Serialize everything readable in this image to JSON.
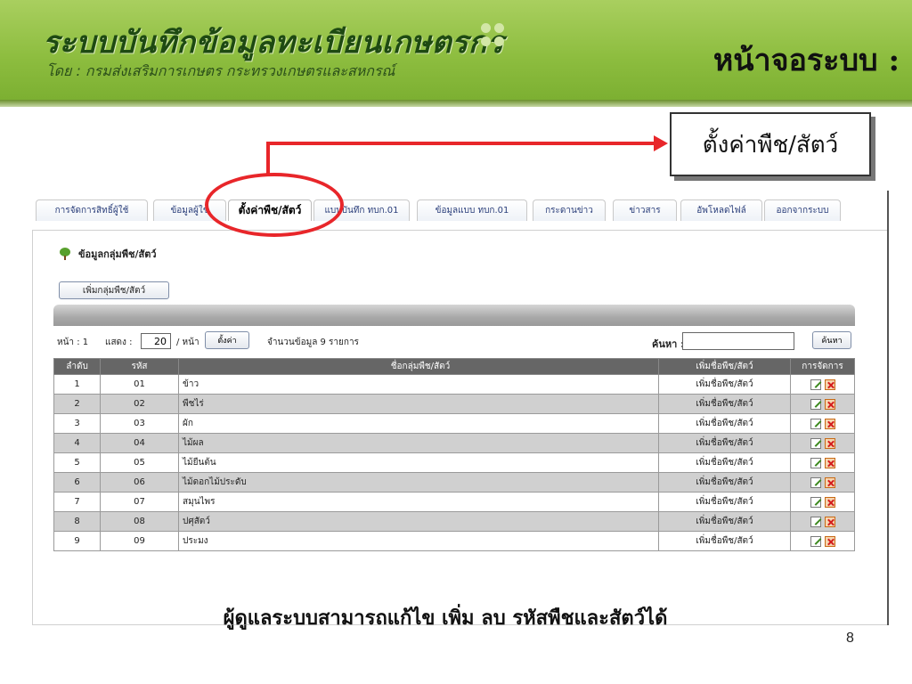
{
  "banner": {
    "logo_title": "ระบบบันทึกข้อมูลทะเบียนเกษตรกร",
    "logo_subtitle": "โดย : กรมส่งเสริมการเกษตร กระทรวงเกษตรและสหกรณ์",
    "screen_title": "หน้าจอระบบ :",
    "color": "#8dbd3f"
  },
  "callout": {
    "label": "ตั้งค่าพืช/สัตว์",
    "arrow_color": "#e8262a"
  },
  "tabs": [
    {
      "label": "การจัดการสิทธิ์ผู้ใช้"
    },
    {
      "label": "ข้อมูลผู้ใช้"
    },
    {
      "label": "ตั้งค่าพืช/สัตว์"
    },
    {
      "label": "แบบบันทึก ทบก.01"
    },
    {
      "label": "ข้อมูลแบบ ทบก.01"
    },
    {
      "label": "กระดานข่าว"
    },
    {
      "label": "ข่าวสาร"
    },
    {
      "label": "อัพโหลดไฟล์"
    },
    {
      "label": "ออกจากระบบ"
    }
  ],
  "section": {
    "title": "ข้อมูลกลุ่มพืช/สัตว์",
    "add_button": "เพิ่มกลุ่มพืช/สัตว์"
  },
  "pager": {
    "page_label": "หน้า : 1",
    "show_label": "แสดง :",
    "page_size": "20",
    "per_page_label": "/ หน้า",
    "set_button": "ตั้งค่า",
    "record_count": "จำนวนข้อมูล 9 รายการ",
    "search_label": "ค้นหา :",
    "search_value": "",
    "search_button": "ค้นหา"
  },
  "table": {
    "headers": {
      "no": "ลำดับ",
      "code": "รหัส",
      "name": "ชื่อกลุ่มพืช/สัตว์",
      "add": "เพิ่มชื่อพืช/สัตว์",
      "action": "การจัดการ"
    },
    "add_link": "เพิ่มชื่อพืช/สัตว์",
    "rows": [
      {
        "no": "1",
        "code": "01",
        "name": "ข้าว"
      },
      {
        "no": "2",
        "code": "02",
        "name": "พืชไร่"
      },
      {
        "no": "3",
        "code": "03",
        "name": "ผัก"
      },
      {
        "no": "4",
        "code": "04",
        "name": "ไม้ผล"
      },
      {
        "no": "5",
        "code": "05",
        "name": "ไม้ยืนต้น"
      },
      {
        "no": "6",
        "code": "06",
        "name": "ไม้ดอกไม้ประดับ"
      },
      {
        "no": "7",
        "code": "07",
        "name": "สมุนไพร"
      },
      {
        "no": "8",
        "code": "08",
        "name": "ปศุสัตว์"
      },
      {
        "no": "9",
        "code": "09",
        "name": "ประมง"
      }
    ]
  },
  "caption": "ผู้ดูแลระบบสามารถแก้ไข เพิ่ม ลบ รหัสพืชและสัตว์ได้",
  "page_number": "8",
  "icons": {
    "edit": "edit-icon",
    "delete": "delete-icon",
    "section": "tree-icon"
  }
}
